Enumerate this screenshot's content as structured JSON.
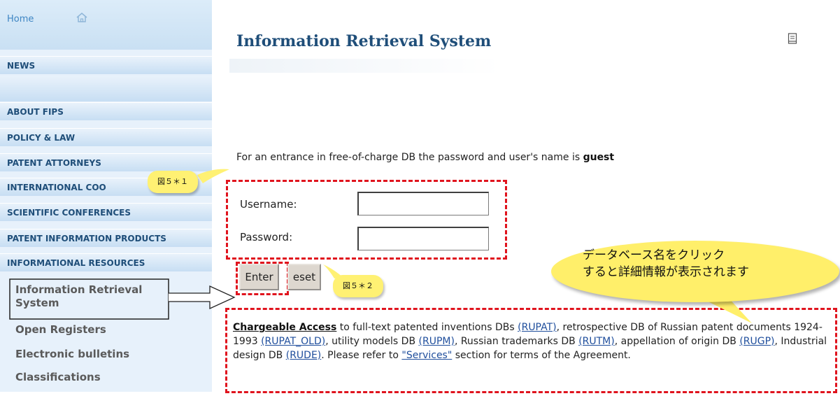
{
  "sidebar": {
    "home": "Home",
    "nav": [
      "NEWS",
      "ABOUT FIPS",
      "POLICY & LAW",
      "PATENT ATTORNEYS",
      "INTERNATIONAL COO",
      "SCIENTIFIC CONFERENCES",
      "PATENT INFORMATION PRODUCTS",
      "INFORMATIONAL RESOURCES"
    ],
    "sub": [
      "Information Retrieval System",
      "Open Registers",
      "Electronic bulletins",
      "Classifications"
    ]
  },
  "main": {
    "title": "Information Retrieval System",
    "notice_text": "For an entrance in free-of-charge DB the password and user's name is ",
    "notice_bold": "guest",
    "username_label": "Username:",
    "password_label": "Password:",
    "username_value": "",
    "password_value": "",
    "enter_label": "Enter",
    "reset_label": "eset",
    "desc": {
      "chargeable": "Chargeable Access",
      "t1": " to full-text patented inventions DBs ",
      "rupat": "(RUPAT)",
      "t2": ", retrospective DB of Russian patent documents 1924-1993 ",
      "rupat_old": "(RUPAT_OLD)",
      "t3": ", utility models DB ",
      "rupm": "(RUPM)",
      "t4": ",  Russian trademarks DB ",
      "rutm": "(RUTM)",
      "t5": ", appellation of origin DB ",
      "rugp": "(RUGP)",
      "t6": ", Industrial design DB ",
      "rude": "(RUDE)",
      "t7": ". Please refer to ",
      "services": "\"Services\"",
      "t8": " section for terms of the Agreement."
    }
  },
  "callouts": {
    "fig1": "図５＊１",
    "fig2": "図５＊２",
    "bubble_line1": "データベース名をクリック",
    "bubble_line2": "すると詳細情報が表示されます"
  },
  "colors": {
    "annotation_red": "#e0141e",
    "callout_yellow": "#fff173",
    "nav_text": "#1f4e79"
  }
}
